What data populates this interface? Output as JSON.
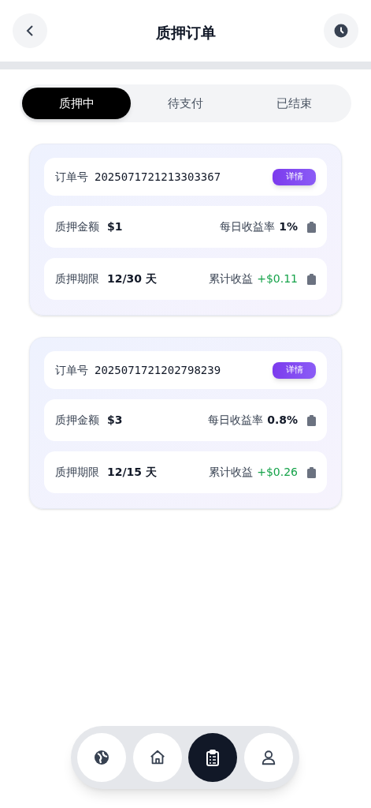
{
  "header": {
    "title": "质押订单"
  },
  "tabs": [
    {
      "label": "质押中",
      "selected": true
    },
    {
      "label": "待支付",
      "selected": false
    },
    {
      "label": "已结束",
      "selected": false
    }
  ],
  "orders": [
    {
      "order_label": "订单号",
      "order_no": "2025071721213303367",
      "detail_button": "详情",
      "amount_label": "质押金额",
      "amount": "$1",
      "rate_label": "每日收益率",
      "rate": "1%",
      "term_label": "质押期限",
      "term": "12/30 天",
      "earnings_label": "累计收益",
      "earnings": "+$0.11"
    },
    {
      "order_label": "订单号",
      "order_no": "2025071721202798239",
      "detail_button": "详情",
      "amount_label": "质押金额",
      "amount": "$3",
      "rate_label": "每日收益率",
      "rate": "0.8%",
      "term_label": "质押期限",
      "term": "12/15 天",
      "earnings_label": "累计收益",
      "earnings": "+$0.26"
    }
  ],
  "bottom_nav": [
    {
      "kind": "globe",
      "selected": false
    },
    {
      "kind": "home",
      "selected": false
    },
    {
      "kind": "orders",
      "selected": true
    },
    {
      "kind": "profile",
      "selected": false
    }
  ]
}
